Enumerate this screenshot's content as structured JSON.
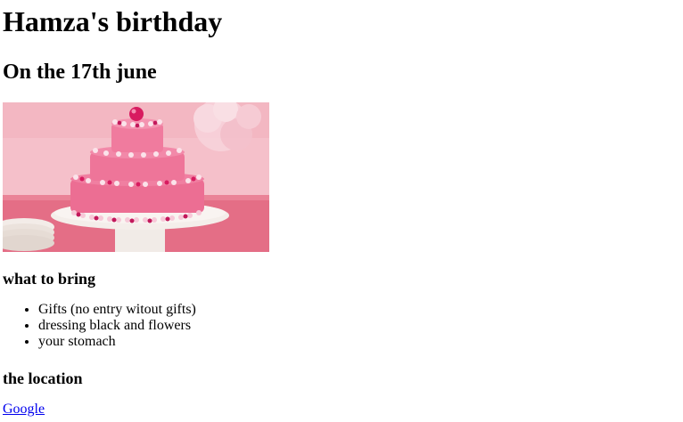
{
  "title": "Hamza's birthday",
  "subtitle": "On the 17th june",
  "image": {
    "description_icon": "birthday-cake-image"
  },
  "bring": {
    "heading": "what to bring",
    "items": [
      "Gifts (no entry witout gifts)",
      "dressing black and flowers",
      "your stomach"
    ]
  },
  "location": {
    "heading": "the location",
    "link_text": "Google"
  },
  "colors": {
    "link": "#0000ee",
    "cake_pink": "#e8628a",
    "background_pink": "#f4b6c2"
  }
}
